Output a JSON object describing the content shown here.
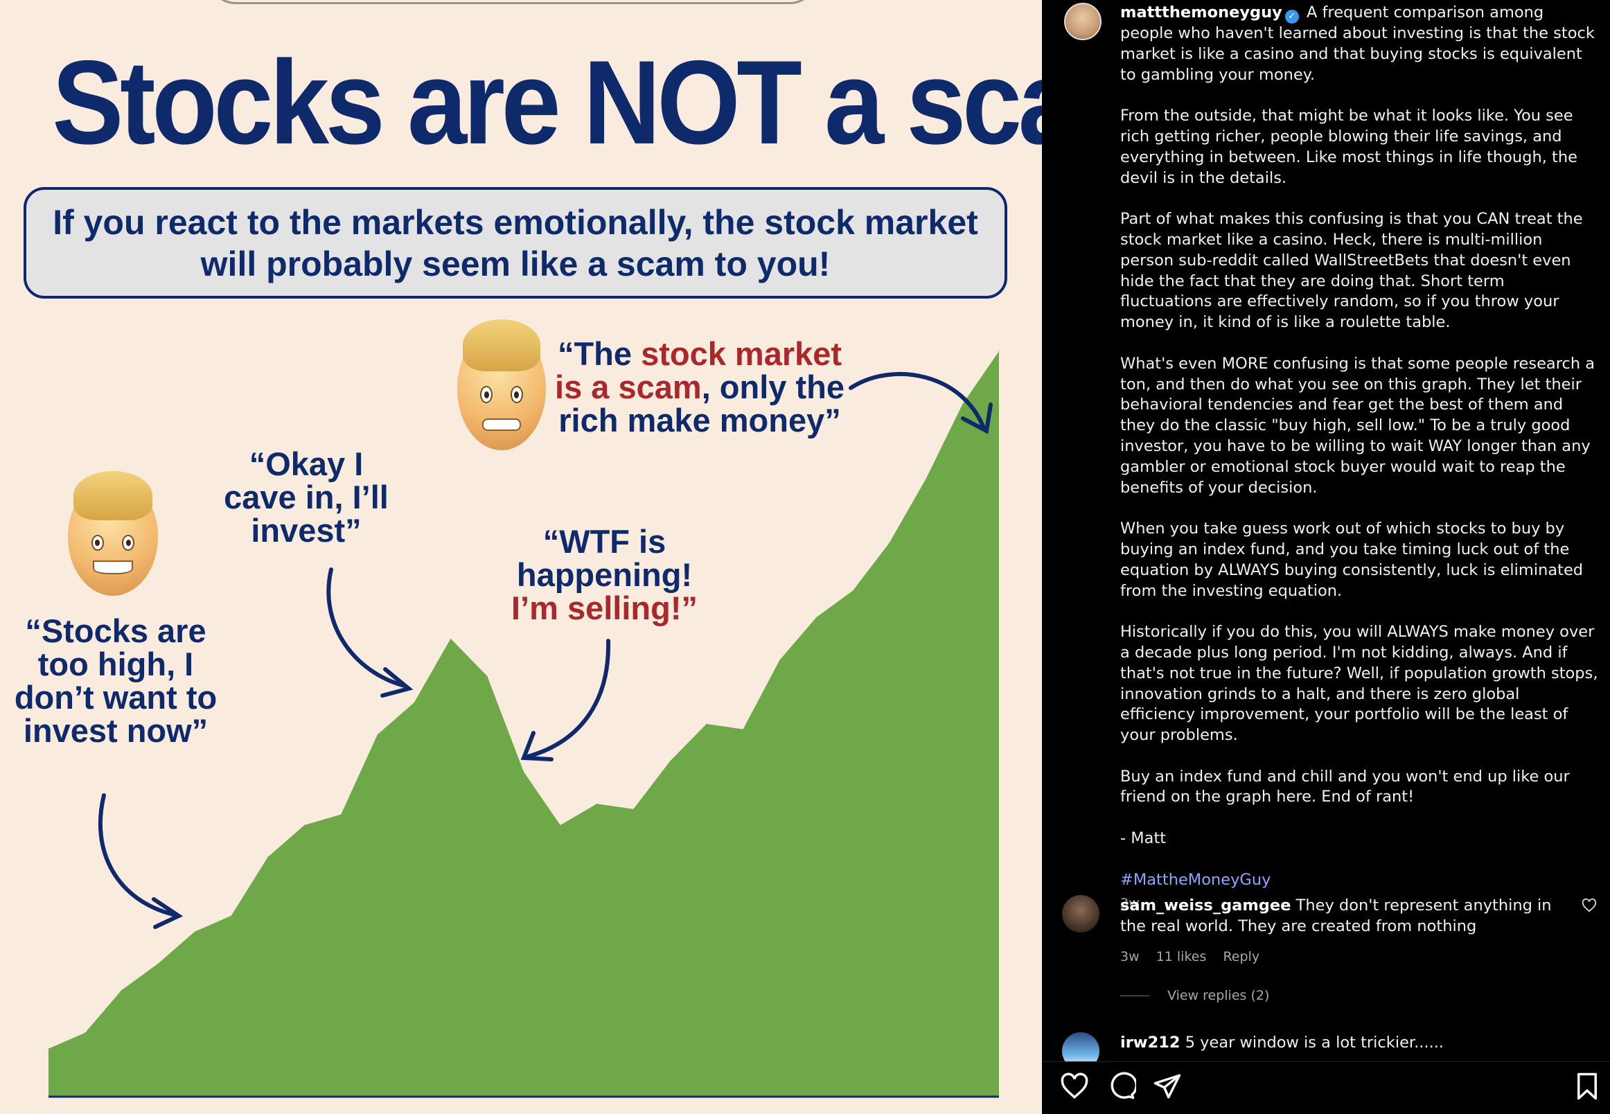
{
  "post_image": {
    "headline": "Stocks are NOT a scam",
    "subtitle_line1": "If you react to the markets emotionally, the stock market",
    "subtitle_line2": "will probably seem like a scam to you!",
    "quote1": "“Stocks are too high, I don’t want to invest now”",
    "quote2": "“Okay I cave in, I’ll invest”",
    "quote3_part1": "“WTF is happening!",
    "quote3_part2": "I’m selling!”",
    "quote4_a": "“The ",
    "quote4_b": "stock market is a scam",
    "quote4_c": ", only the rich make money”",
    "colors": {
      "headline": "#0f2a6b",
      "area": "#6ea848",
      "red_text": "#a8282c",
      "background": "#f9ebdd"
    }
  },
  "chart_data": {
    "type": "area",
    "title": "",
    "xlabel": "",
    "ylabel": "",
    "grid": false,
    "series": [
      {
        "values": [
          9,
          12,
          20,
          25,
          31,
          34,
          45,
          51,
          53,
          68,
          74,
          86,
          79,
          61,
          51,
          55,
          54,
          63,
          70,
          69,
          82,
          90,
          95,
          104,
          116,
          130,
          140
        ]
      }
    ],
    "ylim": [
      0,
      150
    ]
  },
  "sidebar": {
    "author": {
      "username": "mattthemoneyguy",
      "verified_icon": "✓",
      "caption_paragraphs": [
        "A frequent comparison among people who haven't learned about investing is that the stock market is like a casino and that buying stocks is equivalent to gambling your money.",
        "From the outside, that might be what it looks like. You see rich getting richer, people blowing their life savings, and everything in between. Like most things in life though, the devil is in the details.",
        "Part of what makes this confusing is that you CAN treat the stock market like a casino. Heck, there is multi-million person sub-reddit called WallStreetBets that doesn't even hide the fact that they are doing that. Short term fluctuations are effectively random, so if you throw your money in, it kind of is like a roulette table.",
        "What's even MORE confusing is that some people research a ton, and then do what you see on this graph. They let their behavioral tendencies and fear get the best of them and they do the classic \"buy high, sell low.\" To be a truly good investor, you have to be willing to wait WAY longer than any gambler or emotional stock buyer would wait to reap the benefits of your decision.",
        "When you take guess work out of which stocks to buy by buying an index fund, and you take timing luck out of the equation by ALWAYS buying consistently, luck is eliminated from the investing equation.",
        "Historically if you do this, you will ALWAYS make money over a decade plus long period. I'm not kidding, always. And if that's not true in the future? Well, if population growth stops, innovation grinds to a halt, and there is zero global efficiency improvement, your portfolio will be the least of your problems.",
        "Buy an index fund and chill and you won't end up like our friend on the graph here. End of rant!",
        "- Matt"
      ],
      "hashtag": "#MattheMoneyGuy",
      "time": "3w"
    },
    "comments": [
      {
        "username": "sam_weiss_gamgee",
        "text": "They don't represent anything in the real world. They are created from nothing",
        "time": "3w",
        "likes": "11 likes",
        "reply": "Reply"
      },
      {
        "username": "irw212",
        "text": "5 year window is a lot trickier......"
      }
    ],
    "view_replies": "View replies (2)",
    "actions": [
      "heart-icon",
      "comment-icon",
      "share-icon",
      "bookmark-icon"
    ]
  }
}
